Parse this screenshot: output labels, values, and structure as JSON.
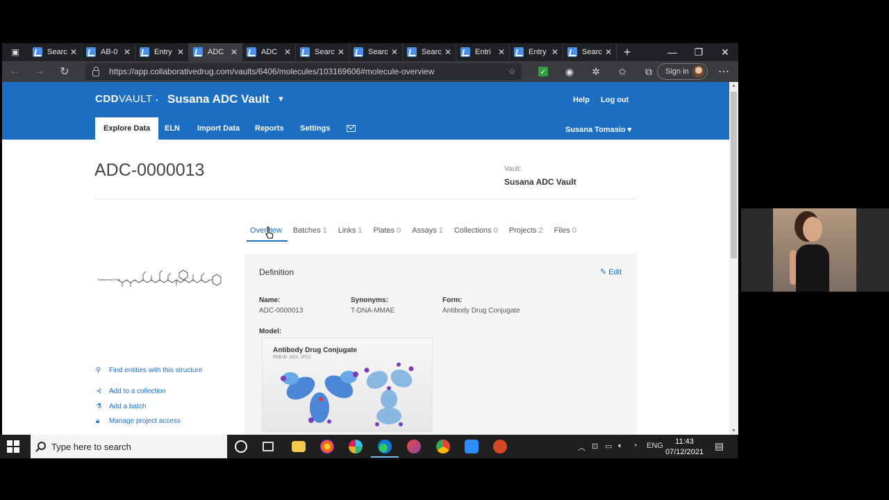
{
  "browser": {
    "tabs": [
      {
        "title": "Searc",
        "active": false
      },
      {
        "title": "AB-0",
        "active": false
      },
      {
        "title": "Entry",
        "active": false
      },
      {
        "title": "ADC",
        "active": true
      },
      {
        "title": "ADC",
        "active": false
      },
      {
        "title": "Searc",
        "active": false
      },
      {
        "title": "Searc",
        "active": false
      },
      {
        "title": "Searc",
        "active": false
      },
      {
        "title": "Entri",
        "active": false
      },
      {
        "title": "Entry",
        "active": false
      },
      {
        "title": "Searc",
        "active": false
      }
    ],
    "new_tab": "+",
    "url": "https://app.collaborativedrug.com/vaults/6406/molecules/103169606#molecule-overview",
    "sign_in_label": "Sign in",
    "window_controls": [
      "—",
      "❐",
      "✕"
    ]
  },
  "app": {
    "logo_cdd": "CDD",
    "logo_vault": "VAULT",
    "vault_name": "Susana ADC Vault",
    "header_links": {
      "help": "Help",
      "logout": "Log out"
    },
    "nav_tabs": [
      "Explore Data",
      "ELN",
      "Import Data",
      "Reports",
      "Settings"
    ],
    "active_nav": "Explore Data",
    "user_name": "Susana Tomasio ▾"
  },
  "molecule": {
    "title": "ADC-0000013",
    "vault_label": "Vault:",
    "vault_value": "Susana ADC Vault",
    "structure_label": "Trastuzumab DNA"
  },
  "subtabs": [
    {
      "label": "Overview",
      "count": "",
      "active": true
    },
    {
      "label": "Batches",
      "count": "1"
    },
    {
      "label": "Links",
      "count": "1"
    },
    {
      "label": "Plates",
      "count": "0"
    },
    {
      "label": "Assays",
      "count": "1"
    },
    {
      "label": "Collections",
      "count": "0"
    },
    {
      "label": "Projects",
      "count": "2"
    },
    {
      "label": "Files",
      "count": "0"
    }
  ],
  "side_links": [
    {
      "label": "Find entities with this structure",
      "icon": "search-icon"
    },
    {
      "label": "Add to a collection",
      "icon": "collection-icon"
    },
    {
      "label": "Add a batch",
      "icon": "flask-icon"
    },
    {
      "label": "Manage project access",
      "icon": "lock-icon"
    }
  ],
  "definition": {
    "heading": "Definition",
    "edit_label": "Edit",
    "fields": [
      {
        "label": "Name:",
        "value": "ADC-0000013"
      },
      {
        "label": "Synonyms:",
        "value": "T-DNA-MMAE"
      },
      {
        "label": "Form:",
        "value": "Antibody Drug Conjugate"
      }
    ],
    "model_label": "Model:",
    "model_title": "Antibody Drug Conjugate",
    "model_subtitle": "PDB ID: 2IG2, 1FC2"
  },
  "taskbar": {
    "search_placeholder": "Type here to search",
    "language": "ENG",
    "time": "11:43",
    "date": "07/12/2021"
  },
  "colors": {
    "brand_blue": "#1b6ec2",
    "panel_bg": "#f5f5f5"
  }
}
